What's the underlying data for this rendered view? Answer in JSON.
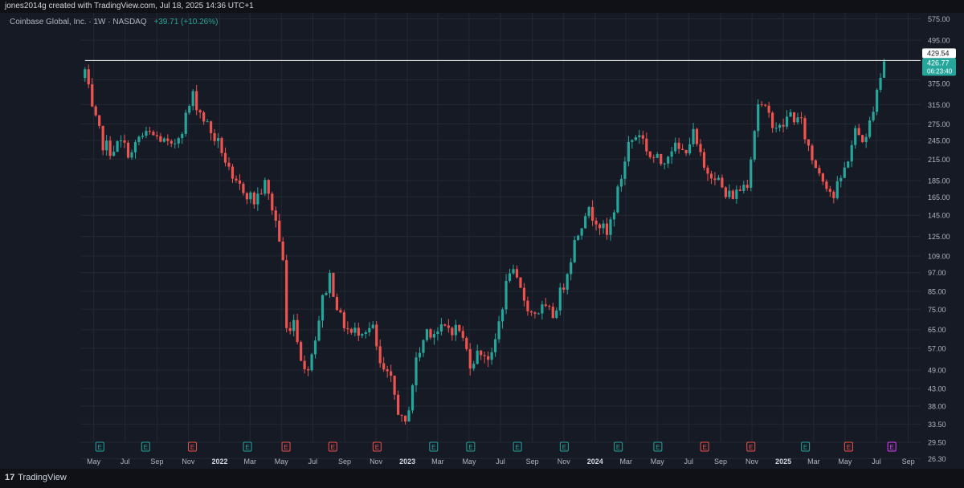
{
  "attribution": "jones2014g created with TradingView.com, Jul 18, 2025 14:36 UTC+1",
  "header": {
    "symbol": "Coinbase Global, Inc. · 1W · NASDAQ",
    "change": "+39.71 (+10.26%)"
  },
  "footer": {
    "brand_mark": "17",
    "brand": "TradingView"
  },
  "colors": {
    "up": "#26a69a",
    "down": "#ef5350",
    "background": "#161a25",
    "grid": "#242833",
    "line": "#ffffff",
    "earnings_purple": "#e040fb"
  },
  "chart_data": {
    "type": "candlestick",
    "interval": "1W",
    "y_scale": "log",
    "ylim": [
      24.5,
      600
    ],
    "xlim": [
      "2021-04-05",
      "2025-09-25"
    ],
    "y_ticks": [
      575,
      495,
      429.54,
      426.77,
      375,
      315,
      275,
      245,
      215,
      185,
      165,
      145,
      125,
      109,
      97,
      85,
      75,
      65,
      57,
      49,
      43,
      38,
      33.5,
      29.5,
      26.3
    ],
    "y_tick_labels": [
      "575.00",
      "495.00",
      "375.00",
      "315.00",
      "275.00",
      "245.00",
      "215.00",
      "185.00",
      "165.00",
      "145.00",
      "125.00",
      "109.00",
      "97.00",
      "85.00",
      "75.00",
      "65.00",
      "57.00",
      "49.00",
      "43.00",
      "38.00",
      "33.50",
      "29.50",
      "26.30"
    ],
    "x_ticks": [
      {
        "label": "May",
        "date": "2021-05-01"
      },
      {
        "label": "Jul",
        "date": "2021-07-01"
      },
      {
        "label": "Sep",
        "date": "2021-09-01"
      },
      {
        "label": "Nov",
        "date": "2021-11-01"
      },
      {
        "label": "2022",
        "date": "2022-01-01"
      },
      {
        "label": "Mar",
        "date": "2022-03-01"
      },
      {
        "label": "May",
        "date": "2022-05-01"
      },
      {
        "label": "Jul",
        "date": "2022-07-01"
      },
      {
        "label": "Sep",
        "date": "2022-09-01"
      },
      {
        "label": "Nov",
        "date": "2022-11-01"
      },
      {
        "label": "2023",
        "date": "2023-01-01"
      },
      {
        "label": "Mar",
        "date": "2023-03-01"
      },
      {
        "label": "May",
        "date": "2023-05-01"
      },
      {
        "label": "Jul",
        "date": "2023-07-01"
      },
      {
        "label": "Sep",
        "date": "2023-09-01"
      },
      {
        "label": "Nov",
        "date": "2023-11-01"
      },
      {
        "label": "2024",
        "date": "2024-01-01"
      },
      {
        "label": "Mar",
        "date": "2024-03-01"
      },
      {
        "label": "May",
        "date": "2024-05-01"
      },
      {
        "label": "Jul",
        "date": "2024-07-01"
      },
      {
        "label": "Sep",
        "date": "2024-09-01"
      },
      {
        "label": "Nov",
        "date": "2024-11-01"
      },
      {
        "label": "2025",
        "date": "2025-01-01"
      },
      {
        "label": "Mar",
        "date": "2025-03-01"
      },
      {
        "label": "May",
        "date": "2025-05-01"
      },
      {
        "label": "Jul",
        "date": "2025-07-01"
      },
      {
        "label": "Sep",
        "date": "2025-09-01"
      }
    ],
    "horizontal_line": {
      "value": 429.54,
      "label": "429.54",
      "start_date": "2021-04-14"
    },
    "last_price": {
      "value": 426.77,
      "label": "426.77",
      "countdown": "06:23:40"
    },
    "earnings": [
      {
        "date": "2021-05-13",
        "kind": "beat",
        "label": "E"
      },
      {
        "date": "2021-08-10",
        "kind": "beat",
        "label": "E"
      },
      {
        "date": "2021-11-09",
        "kind": "miss",
        "label": "E"
      },
      {
        "date": "2022-02-24",
        "kind": "beat",
        "label": "E"
      },
      {
        "date": "2022-05-10",
        "kind": "miss",
        "label": "E"
      },
      {
        "date": "2022-08-09",
        "kind": "miss",
        "label": "E"
      },
      {
        "date": "2022-11-03",
        "kind": "miss",
        "label": "E"
      },
      {
        "date": "2023-02-21",
        "kind": "beat",
        "label": "E"
      },
      {
        "date": "2023-05-04",
        "kind": "beat",
        "label": "E"
      },
      {
        "date": "2023-08-03",
        "kind": "beat",
        "label": "E"
      },
      {
        "date": "2023-11-02",
        "kind": "beat",
        "label": "E"
      },
      {
        "date": "2024-02-15",
        "kind": "beat",
        "label": "E"
      },
      {
        "date": "2024-05-02",
        "kind": "beat",
        "label": "E"
      },
      {
        "date": "2024-08-01",
        "kind": "miss",
        "label": "E"
      },
      {
        "date": "2024-10-30",
        "kind": "miss",
        "label": "E"
      },
      {
        "date": "2025-02-13",
        "kind": "beat",
        "label": "E"
      },
      {
        "date": "2025-05-08",
        "kind": "miss",
        "label": "E"
      },
      {
        "date": "2025-07-31",
        "kind": "upcoming",
        "label": "E"
      }
    ],
    "path": [
      [
        "2021-04-14",
        400
      ],
      [
        "2021-04-28",
        300
      ],
      [
        "2021-05-19",
        240
      ],
      [
        "2021-06-02",
        230
      ],
      [
        "2021-06-23",
        240
      ],
      [
        "2021-07-14",
        222
      ],
      [
        "2021-07-28",
        250
      ],
      [
        "2021-08-18",
        255
      ],
      [
        "2021-09-08",
        248
      ],
      [
        "2021-09-29",
        230
      ],
      [
        "2021-10-20",
        270
      ],
      [
        "2021-11-10",
        335
      ],
      [
        "2021-11-24",
        300
      ],
      [
        "2021-12-15",
        260
      ],
      [
        "2022-01-05",
        230
      ],
      [
        "2022-01-26",
        180
      ],
      [
        "2022-02-16",
        175
      ],
      [
        "2022-03-09",
        160
      ],
      [
        "2022-03-30",
        180
      ],
      [
        "2022-04-20",
        140
      ],
      [
        "2022-05-04",
        105
      ],
      [
        "2022-05-11",
        65
      ],
      [
        "2022-05-25",
        70
      ],
      [
        "2022-06-15",
        48
      ],
      [
        "2022-06-29",
        55
      ],
      [
        "2022-07-20",
        80
      ],
      [
        "2022-08-03",
        95
      ],
      [
        "2022-08-24",
        70
      ],
      [
        "2022-09-14",
        63
      ],
      [
        "2022-10-05",
        66
      ],
      [
        "2022-10-26",
        65
      ],
      [
        "2022-11-09",
        50
      ],
      [
        "2022-11-30",
        45
      ],
      [
        "2022-12-21",
        34
      ],
      [
        "2022-12-28",
        33
      ],
      [
        "2023-01-18",
        52
      ],
      [
        "2023-02-08",
        65
      ],
      [
        "2023-03-01",
        64
      ],
      [
        "2023-03-22",
        66
      ],
      [
        "2023-04-12",
        65
      ],
      [
        "2023-05-03",
        52
      ],
      [
        "2023-05-24",
        56
      ],
      [
        "2023-06-14",
        53
      ],
      [
        "2023-07-05",
        78
      ],
      [
        "2023-07-19",
        100
      ],
      [
        "2023-08-09",
        85
      ],
      [
        "2023-08-30",
        73
      ],
      [
        "2023-09-20",
        75
      ],
      [
        "2023-10-11",
        72
      ],
      [
        "2023-11-01",
        90
      ],
      [
        "2023-11-22",
        120
      ],
      [
        "2023-12-13",
        150
      ],
      [
        "2024-01-03",
        143
      ],
      [
        "2024-01-24",
        125
      ],
      [
        "2024-02-14",
        170
      ],
      [
        "2024-03-06",
        240
      ],
      [
        "2024-03-27",
        260
      ],
      [
        "2024-04-17",
        220
      ],
      [
        "2024-05-08",
        210
      ],
      [
        "2024-05-29",
        235
      ],
      [
        "2024-06-19",
        225
      ],
      [
        "2024-07-10",
        255
      ],
      [
        "2024-07-31",
        200
      ],
      [
        "2024-08-21",
        195
      ],
      [
        "2024-09-11",
        165
      ],
      [
        "2024-10-02",
        170
      ],
      [
        "2024-10-23",
        185
      ],
      [
        "2024-11-13",
        320
      ],
      [
        "2024-12-04",
        290
      ],
      [
        "2024-12-25",
        265
      ],
      [
        "2025-01-15",
        295
      ],
      [
        "2025-02-05",
        275
      ],
      [
        "2025-02-26",
        215
      ],
      [
        "2025-03-19",
        190
      ],
      [
        "2025-04-09",
        165
      ],
      [
        "2025-04-30",
        200
      ],
      [
        "2025-05-21",
        260
      ],
      [
        "2025-06-11",
        245
      ],
      [
        "2025-07-02",
        355
      ],
      [
        "2025-07-18",
        426.77
      ]
    ]
  }
}
